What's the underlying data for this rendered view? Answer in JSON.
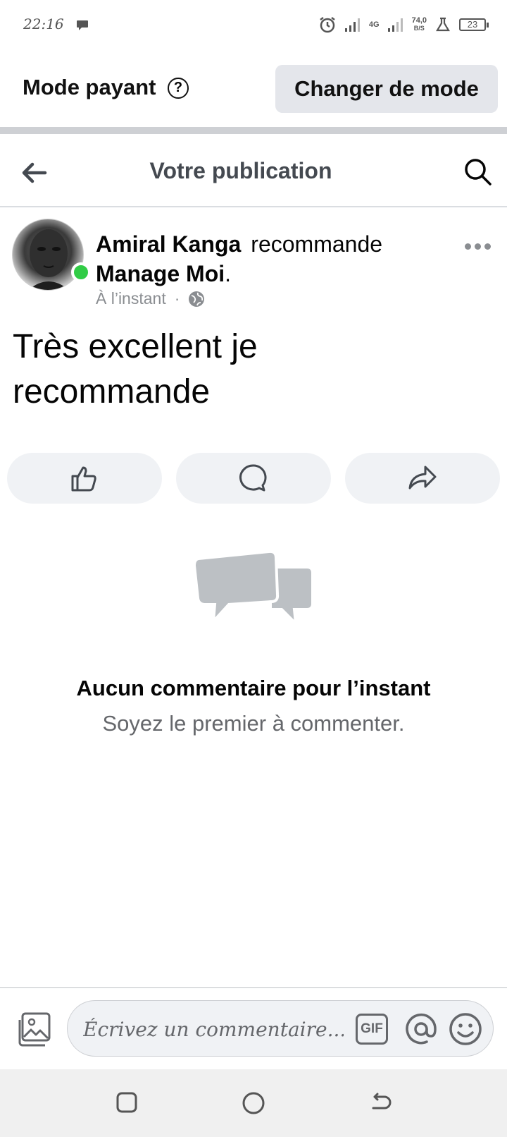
{
  "status_bar": {
    "time": "22:16",
    "network_label": "4G",
    "speed_value": "74,0",
    "speed_unit": "B/S",
    "battery": "23"
  },
  "mode_bar": {
    "label": "Mode payant",
    "help_symbol": "?",
    "change_button": "Changer de mode"
  },
  "header": {
    "title": "Votre publication"
  },
  "post": {
    "author": "Amiral Kanga",
    "action": "recommande",
    "page_name": "Manage Moi",
    "page_suffix": ".",
    "time": "À l’instant",
    "meta_separator": "·",
    "text": "Très excellent je recommande"
  },
  "empty_state": {
    "title": "Aucun commentaire pour l’instant",
    "subtitle": "Soyez le premier à commenter."
  },
  "composer": {
    "placeholder": "Écrivez un commentaire...",
    "gif_label": "GIF"
  },
  "colors": {
    "online": "#31cc46",
    "button_bg": "#f0f2f5",
    "secondary_text": "#65676b"
  },
  "icons": [
    "back-arrow-icon",
    "search-icon",
    "more-icon",
    "like-icon",
    "comment-icon",
    "share-icon",
    "photo-icon",
    "mention-icon",
    "emoji-icon",
    "globe-icon",
    "alarm-icon"
  ]
}
